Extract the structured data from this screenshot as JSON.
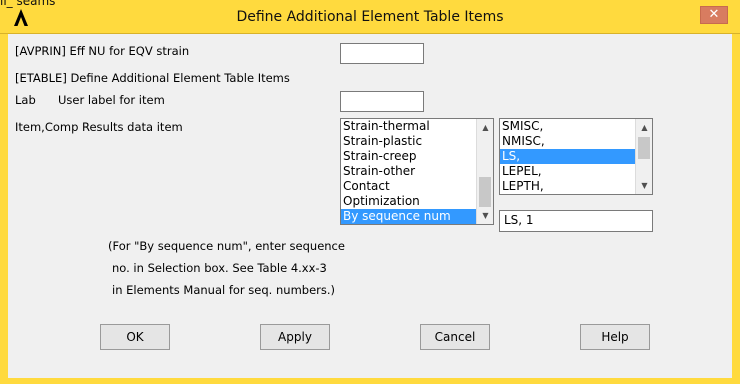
{
  "window": {
    "title": "Define Additional Element Table Items",
    "fragment": "ll_ seams",
    "close_glyph": "✕"
  },
  "form": {
    "avprin_label": "[AVPRIN]  Eff NU for EQV strain",
    "avprin_value": "",
    "etable_label": "[ETABLE]  Define Additional Element Table Items",
    "lab_label": "Lab",
    "lab_desc": "User label for item",
    "lab_value": "",
    "item_label": "Item,Comp",
    "item_desc": "Results data item",
    "item_list": [
      "Strain-thermal",
      "Strain-plastic",
      "Strain-creep",
      "Strain-other",
      "Contact",
      "Optimization",
      "By sequence num"
    ],
    "item_selected_index": 6,
    "comp_list": [
      "SMISC,",
      "NMISC,",
      "LS,",
      "LEPEL,",
      "LEPTH,"
    ],
    "comp_selected_index": 2,
    "selection_value": "LS, 1",
    "note_lines": [
      "(For \"By sequence num\", enter sequence",
      "no. in Selection box.  See Table 4.xx-3",
      "in Elements Manual for seq. numbers.)"
    ]
  },
  "buttons": {
    "ok": "OK",
    "apply": "Apply",
    "cancel": "Cancel",
    "help": "Help"
  },
  "colors": {
    "titlebar": "#ffda3e",
    "selection": "#3399ff",
    "close": "#d87c60"
  }
}
